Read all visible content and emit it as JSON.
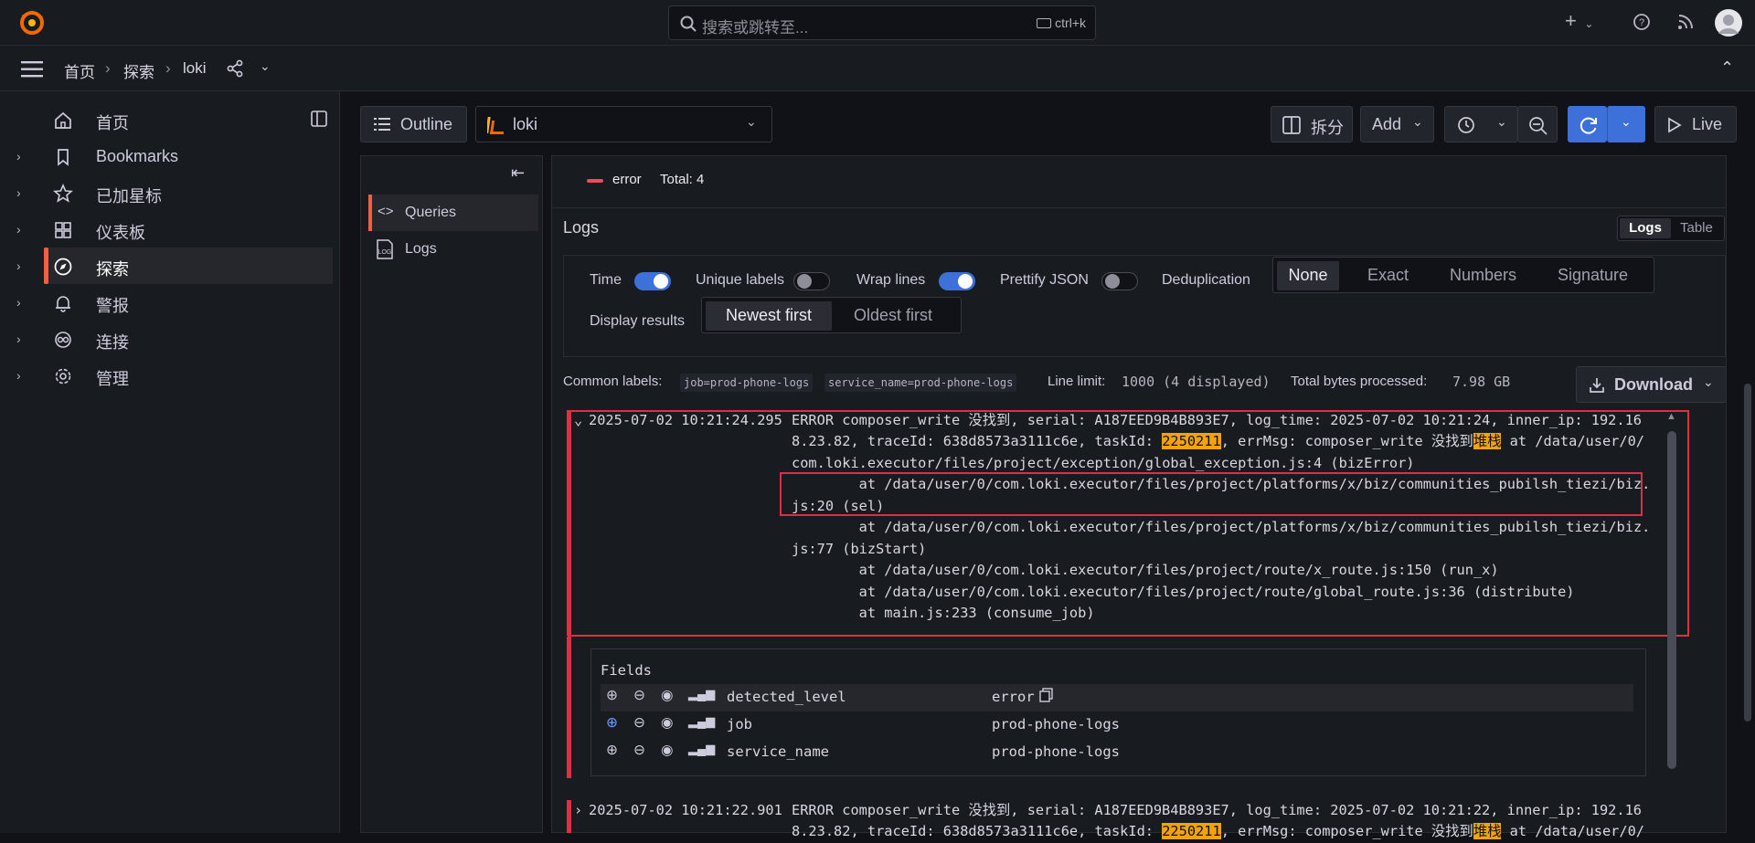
{
  "topbar": {
    "search_placeholder": "搜索或跳转至...",
    "search_shortcut": "ctrl+k",
    "add_icon": "plus-icon",
    "help_icon": "help-icon",
    "news_icon": "rss-icon",
    "avatar_icon": "avatar-icon"
  },
  "breadcrumb": {
    "home": "首页",
    "explore": "探索",
    "datasource": "loki"
  },
  "sidebar": {
    "items": [
      {
        "label": "首页",
        "icon": "home-icon",
        "expandable": false
      },
      {
        "label": "Bookmarks",
        "icon": "bookmark-icon",
        "expandable": true
      },
      {
        "label": "已加星标",
        "icon": "star-icon",
        "expandable": true
      },
      {
        "label": "仪表板",
        "icon": "dashboard-icon",
        "expandable": true
      },
      {
        "label": "探索",
        "icon": "compass-icon",
        "expandable": true,
        "active": true
      },
      {
        "label": "警报",
        "icon": "bell-icon",
        "expandable": true
      },
      {
        "label": "连接",
        "icon": "connections-icon",
        "expandable": true
      },
      {
        "label": "管理",
        "icon": "gear-icon",
        "expandable": true
      }
    ]
  },
  "toolbar": {
    "outline_label": "Outline",
    "datasource": "loki",
    "split_label": "拆分",
    "add_label": "Add",
    "live_label": "Live"
  },
  "outline": {
    "items": [
      {
        "label": "Queries",
        "icon": "code-icon"
      },
      {
        "label": "Logs",
        "icon": "logs-icon"
      }
    ]
  },
  "graph": {
    "legend_label": "error",
    "legend_total": "Total: 4",
    "accent": "#f2495c"
  },
  "logs": {
    "title": "Logs",
    "view_tabs": [
      "Logs",
      "Table"
    ],
    "options": {
      "time_label": "Time",
      "unique_labels_label": "Unique labels",
      "wrap_lines_label": "Wrap lines",
      "prettify_json_label": "Prettify JSON",
      "dedup_label": "Deduplication",
      "dedup_options": [
        "None",
        "Exact",
        "Numbers",
        "Signature"
      ],
      "display_results_label": "Display results",
      "order_options": [
        "Newest first",
        "Oldest first"
      ]
    },
    "meta": {
      "common_labels_label": "Common labels:",
      "common_labels": [
        "job=prod-phone-logs",
        "service_name=prod-phone-logs"
      ],
      "line_limit_label": "Line limit:",
      "line_limit_value": "1000 (4 displayed)",
      "bytes_label": "Total bytes processed:",
      "bytes_value": "7.98 GB",
      "download_label": "Download"
    },
    "entries": [
      {
        "timestamp": "2025-07-02 10:21:24.295",
        "line1": "ERROR composer_write 没找到, serial: A187EED9B4B893E7, log_time: 2025-07-02 10:21:24, inner_ip: 192.16",
        "line2a": "8.23.82, traceId: 638d8573a3111c6e, taskId: ",
        "line2_hl": "2250211",
        "line2b": ", errMsg: composer_write 没找到",
        "line2_hl2": "堆栈",
        "line2c": " at /data/user/0/",
        "line3": "com.loki.executor/files/project/exception/global_exception.js:4 (bizError)",
        "line4": "        at /data/user/0/com.loki.executor/files/project/platforms/x/biz/communities_pubilsh_tiezi/biz.",
        "line5": "js:20 (sel)",
        "line6": "        at /data/user/0/com.loki.executor/files/project/platforms/x/biz/communities_pubilsh_tiezi/biz.",
        "line7": "js:77 (bizStart)",
        "line8": "        at /data/user/0/com.loki.executor/files/project/route/x_route.js:150 (run_x)",
        "line9": "        at /data/user/0/com.loki.executor/files/project/route/global_route.js:36 (distribute)",
        "line10": "        at main.js:233 (consume_job)"
      },
      {
        "timestamp": "2025-07-02 10:21:22.901",
        "line1": "ERROR composer_write 没找到, serial: A187EED9B4B893E7, log_time: 2025-07-02 10:21:22, inner_ip: 192.16",
        "line2a": "8.23.82, traceId: 638d8573a3111c6e, taskId: ",
        "line2_hl": "2250211",
        "line2b": ", errMsg: composer_write 没找到",
        "line2_hl2": "堆栈",
        "line2c": " at /data/user/0/"
      }
    ],
    "fields": {
      "title": "Fields",
      "rows": [
        {
          "name": "detected_level",
          "value": "error"
        },
        {
          "name": "job",
          "value": "prod-phone-logs"
        },
        {
          "name": "service_name",
          "value": "prod-phone-logs"
        }
      ]
    }
  }
}
